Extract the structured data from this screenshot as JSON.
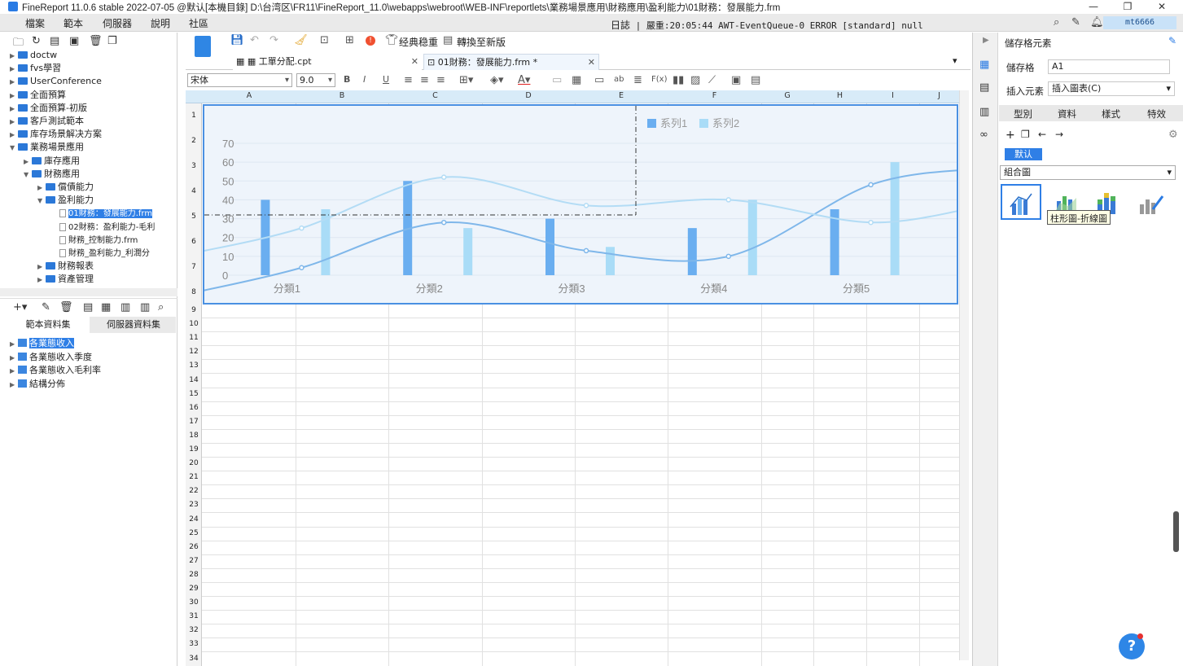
{
  "window": {
    "title": "FineReport 11.0.6 stable 2022-07-05 @默认[本機目錄]    D:\\台湾区\\FR11\\FineReport_11.0\\webapps\\webroot\\WEB-INF\\reportlets\\業務場景應用\\財務應用\\盈利能力\\01財務：發展能力.frm",
    "min": "—",
    "max": "❐",
    "close": "✕"
  },
  "menubar": {
    "items": [
      "檔案",
      "範本",
      "伺服器",
      "說明",
      "社區"
    ],
    "log_label": "日誌",
    "log_text": "| 嚴重:20:05:44 AWT-EventQueue-0 ERROR [standard] null",
    "user": "mt6666"
  },
  "left_panel": {
    "tree": [
      {
        "label": "doctw",
        "indent": 0,
        "type": "folder",
        "expander": "▶"
      },
      {
        "label": "fvs學習",
        "indent": 0,
        "type": "folder",
        "expander": "▶"
      },
      {
        "label": "UserConference",
        "indent": 0,
        "type": "folder",
        "expander": "▶"
      },
      {
        "label": "全面預算",
        "indent": 0,
        "type": "folder",
        "expander": "▶"
      },
      {
        "label": "全面預算-初版",
        "indent": 0,
        "type": "folder",
        "expander": "▶"
      },
      {
        "label": "客戶測試範本",
        "indent": 0,
        "type": "folder",
        "expander": "▶"
      },
      {
        "label": "库存场景解决方案",
        "indent": 0,
        "type": "folder",
        "expander": "▶"
      },
      {
        "label": "業務場景應用",
        "indent": 0,
        "type": "folder",
        "expander": "▼"
      },
      {
        "label": "庫存應用",
        "indent": 1,
        "type": "folder",
        "expander": "▶"
      },
      {
        "label": "財務應用",
        "indent": 1,
        "type": "folder",
        "expander": "▼"
      },
      {
        "label": "償債能力",
        "indent": 2,
        "type": "folder",
        "expander": "▶"
      },
      {
        "label": "盈利能力",
        "indent": 2,
        "type": "folder",
        "expander": "▼"
      },
      {
        "label": "01財務：發展能力.frm",
        "indent": 3,
        "type": "file",
        "expander": "",
        "selected": true
      },
      {
        "label": "02財務：盈利能力-毛利",
        "indent": 3,
        "type": "file",
        "expander": ""
      },
      {
        "label": "財務_控制能力.frm",
        "indent": 3,
        "type": "file",
        "expander": ""
      },
      {
        "label": "財務_盈利能力_利潤分",
        "indent": 3,
        "type": "file",
        "expander": ""
      },
      {
        "label": "財務報表",
        "indent": 2,
        "type": "folder",
        "expander": "▶"
      },
      {
        "label": "資產管理",
        "indent": 2,
        "type": "folder",
        "expander": "▶"
      }
    ],
    "dataset_tabs": [
      "範本資料集",
      "伺服器資料集"
    ],
    "datasets": [
      {
        "label": "各業態收入",
        "selected": true
      },
      {
        "label": "各業態收入季度",
        "selected": false
      },
      {
        "label": "各業態收入毛利率",
        "selected": false
      },
      {
        "label": "結構分佈",
        "selected": false
      }
    ]
  },
  "toolbar": {
    "classic_label": "经典稳重",
    "convert_label": "轉換至新版",
    "badge": "!"
  },
  "tabs": [
    {
      "label": "工單分配.cpt",
      "close": "✕"
    },
    {
      "label": "01財務：發展能力.frm *",
      "close": "✕"
    }
  ],
  "format": {
    "font": "宋体",
    "size": "9.0"
  },
  "sheet": {
    "columns": [
      "A",
      "B",
      "C",
      "D",
      "E",
      "F",
      "G",
      "H",
      "I",
      "J"
    ],
    "rows": [
      "1",
      "2",
      "3",
      "4",
      "5",
      "6",
      "7",
      "8",
      "9",
      "10",
      "11",
      "12",
      "13",
      "14",
      "15",
      "16",
      "17",
      "18",
      "19",
      "20",
      "21",
      "22",
      "23",
      "24",
      "25",
      "26",
      "27",
      "28",
      "29",
      "30",
      "31",
      "32",
      "33",
      "34"
    ]
  },
  "chart_data": {
    "type": "bar",
    "categories": [
      "分類1",
      "分類2",
      "分類3",
      "分類4",
      "分類5"
    ],
    "series": [
      {
        "name": "系列1",
        "type": "bar",
        "values": [
          40,
          50,
          30,
          25,
          35
        ],
        "color": "#6aaef0"
      },
      {
        "name": "系列2",
        "type": "bar",
        "values": [
          35,
          25,
          15,
          40,
          60
        ],
        "color": "#a9dcf7"
      },
      {
        "name": "",
        "type": "line",
        "values": [
          4,
          28,
          13,
          10,
          48
        ],
        "color": "#7fb7ea"
      },
      {
        "name": "",
        "type": "line",
        "values": [
          25,
          52,
          37,
          40,
          28
        ],
        "color": "#b3dcf5"
      }
    ],
    "ylim": [
      0,
      70
    ],
    "yticks": [
      "0",
      "10",
      "20",
      "30",
      "40",
      "50",
      "60",
      "70"
    ],
    "legend": "top"
  },
  "right_panel": {
    "header": "儲存格元素",
    "cell_label": "儲存格",
    "cell_value": "A1",
    "insert_label": "插入元素",
    "insert_value": "插入圖表(C)",
    "tabs": [
      "型別",
      "資料",
      "樣式",
      "特效"
    ],
    "default_btn": "默认",
    "chart_category": "組合圖",
    "tooltip": "柱形圖-折線圖"
  },
  "help": "?"
}
